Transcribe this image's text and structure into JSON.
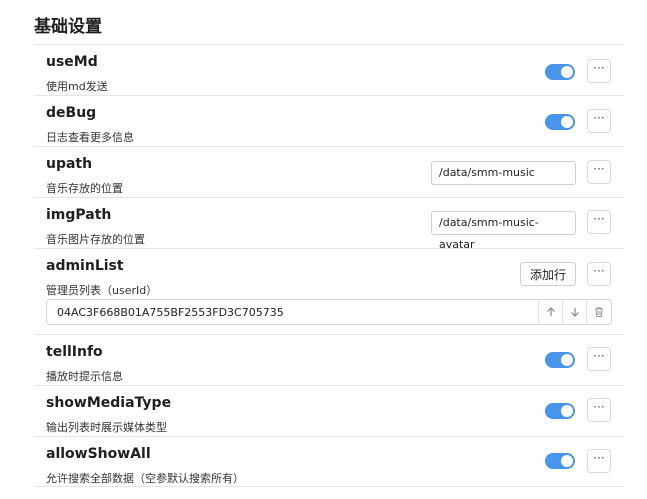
{
  "section": {
    "title": "基础设置"
  },
  "more_label": "···",
  "settings": {
    "useMd": {
      "name": "useMd",
      "desc": "使用md发送",
      "enabled": true
    },
    "deBug": {
      "name": "deBug",
      "desc": "日志查看更多信息",
      "enabled": true
    },
    "upath": {
      "name": "upath",
      "desc": "音乐存放的位置",
      "value": "/data/smm-music"
    },
    "imgPath": {
      "name": "imgPath",
      "desc": "音乐图片存放的位置",
      "value": "/data/smm-music-avatar"
    },
    "adminList": {
      "name": "adminList",
      "desc": "管理员列表（userId）",
      "add_label": "添加行",
      "items": [
        "04AC3F668B01A755BF2553FD3C705735"
      ]
    },
    "tellInfo": {
      "name": "tellInfo",
      "desc": "播放时提示信息",
      "enabled": true
    },
    "showMediaType": {
      "name": "showMediaType",
      "desc": "输出列表时展示媒体类型",
      "enabled": true
    },
    "allowShowAll": {
      "name": "allowShowAll",
      "desc": "允许搜索全部数据（空参默认搜索所有）",
      "enabled": true
    }
  },
  "colors": {
    "toggle_on": "#4a95ec",
    "divider": "#e6e6e6"
  },
  "icons": [
    "arrow-up-icon",
    "arrow-down-icon",
    "trash-icon",
    "more-icon"
  ]
}
